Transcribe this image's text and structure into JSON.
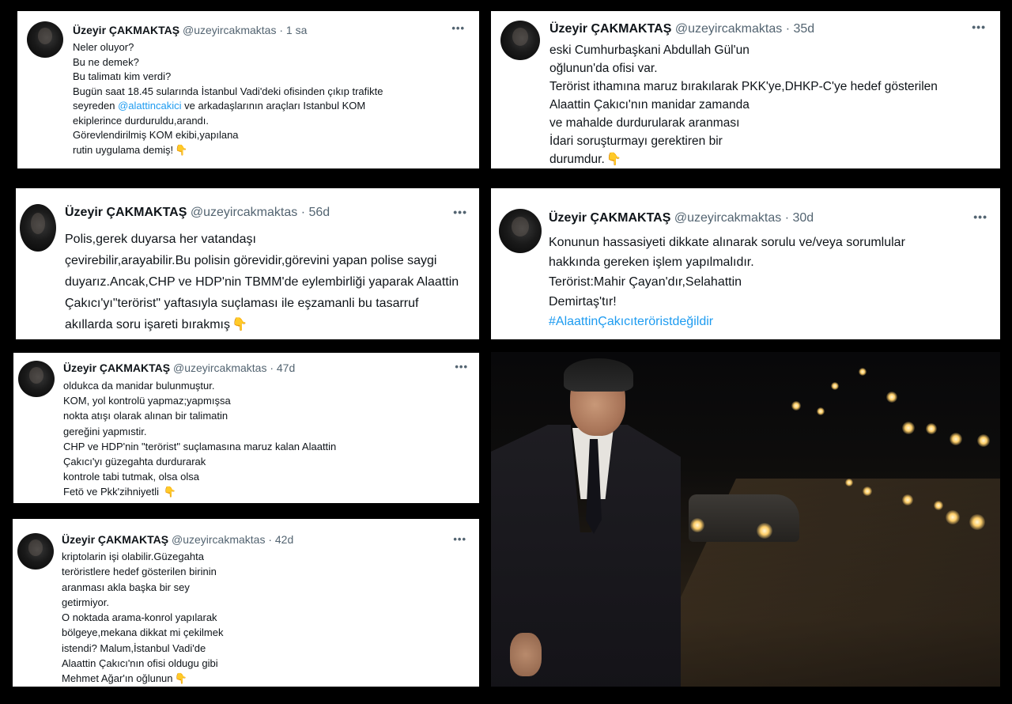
{
  "author": {
    "name": "Üzeyir ÇAKMAKTAŞ",
    "handle": "@uzeyircakmaktas"
  },
  "more_icon": "more-dots-icon",
  "emoji_icon": "pointing-down-hand-icon",
  "tweets": [
    {
      "time": "· 1 sa",
      "lines": [
        "Neler oluyor?",
        "Bu ne demek?",
        "Bu talimatı kim verdi?",
        "Bugün saat 18.45 sularında İstanbul Vadi'deki ofisinden çıkıp trafikte",
        "seyreden",
        "@alattincakici",
        " ve arkadaşlarının araçları Istanbul KOM",
        "ekiplerince durduruldu,arandı.",
        "Görevlendirilmiş KOM ekibi,yapılana",
        "rutin uygulama demiş!"
      ]
    },
    {
      "time": "· 35d",
      "lines": [
        "eski Cumhurbaşkani Abdullah Gül'un",
        "oğlunun'da ofisi var.",
        "Terörist ithamına maruz bırakılarak PKK'ye,DHKP-C'ye hedef gösterilen",
        "Alaattin Çakıcı'nın manidar zamanda",
        "ve mahalde durdurularak aranması",
        "İdari soruşturmayı gerektiren bir",
        "durumdur."
      ]
    },
    {
      "time": "· 56d",
      "lines": [
        "Polis,gerek duyarsa her vatandaşı",
        "çevirebilir,arayabilir.Bu polisin görevidir,görevini yapan polise saygi",
        "duyarız.Ancak,CHP ve HDP'nin TBMM'de eylembirliği yaparak Alaattin",
        "Çakıcı'yı\"terörist\" yaftasıyla suçlaması ile eşzamanli bu tasarruf",
        "akıllarda soru işareti bırakmış"
      ]
    },
    {
      "time": "· 30d",
      "lines": [
        "Konunun hassasiyeti dikkate alınarak sorulu ve/veya sorumlular",
        "hakkında gereken işlem yapılmalıdır.",
        "Terörist:Mahir Çayan'dır,Selahattin",
        "Demirtaş'tır!",
        "#AlaattinÇakıcıteröristdeğildir"
      ]
    },
    {
      "time": "· 47d",
      "lines": [
        "oldukca da manidar bulunmuştur.",
        "KOM, yol kontrolü yapmaz;yapmışsa",
        "nokta atışı olarak alınan bir talimatin",
        "gereğini yapmıstir.",
        "CHP ve HDP'nin \"terörist\" suçlamasına maruz kalan Alaattin",
        "Çakıcı'yı güzegahta durdurarak",
        "kontrole tabi tutmak, olsa olsa",
        "Fetö ve Pkk'zihniyetli"
      ]
    },
    {
      "time": "· 42d",
      "lines": [
        "kriptolarin işi olabilir.Güzegahta",
        "teröristlere hedef gösterilen birinin",
        "aranması akla başka bir sey",
        "getirmiyor.",
        "O noktada arama-konrol yapılarak",
        "bölgeye,mekana dikkat mi çekilmek",
        "istendi? Malum,İstanbul Vadi'de",
        "Alaattin Çakıcı'nın ofisi oldugu gibi",
        "Mehmet Ağar'ın oğlunun"
      ]
    }
  ],
  "photo": {
    "subject": "man-in-suit-night-road-photo"
  }
}
